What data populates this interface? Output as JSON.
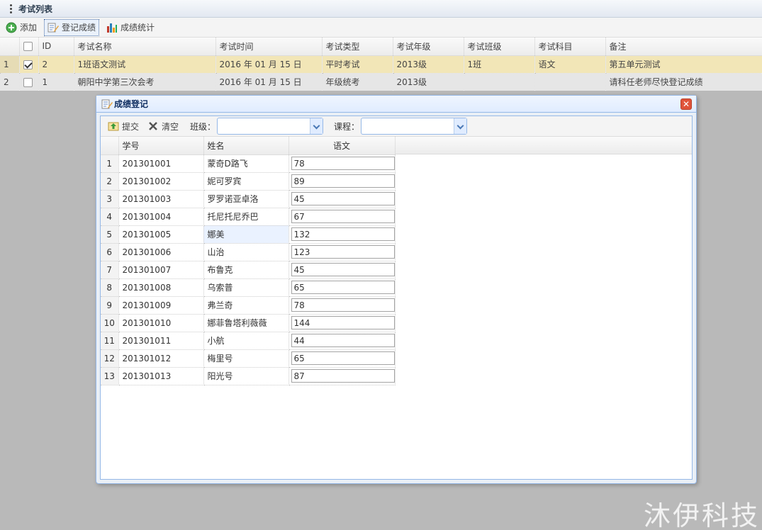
{
  "panel": {
    "title": "考试列表"
  },
  "toolbar": {
    "add_label": "添加",
    "register_label": "登记成绩",
    "stats_label": "成绩统计"
  },
  "grid": {
    "columns": [
      "ID",
      "考试名称",
      "考试时间",
      "考试类型",
      "考试年级",
      "考试班级",
      "考试科目",
      "备注"
    ],
    "rows": [
      {
        "num": "1",
        "checked": true,
        "id": "2",
        "name": "1班语文测试",
        "time": "2016 年 01 月 15 日",
        "type": "平时考试",
        "grade": "2013级",
        "class": "1班",
        "subject": "语文",
        "remark": "第五单元测试"
      },
      {
        "num": "2",
        "checked": false,
        "id": "1",
        "name": "朝阳中学第三次会考",
        "time": "2016 年 01 月 15 日",
        "type": "年级统考",
        "grade": "2013级",
        "class": "",
        "subject": "",
        "remark": "请科任老师尽快登记成绩"
      }
    ]
  },
  "dialog": {
    "title": "成绩登记",
    "submit_label": "提交",
    "clear_label": "清空",
    "class_label": "班级：",
    "course_label": "课程：",
    "class_value": "",
    "course_value": "",
    "columns": [
      "学号",
      "姓名",
      "语文"
    ],
    "students": [
      {
        "num": "1",
        "sid": "201301001",
        "name": "蒙奇D路飞",
        "score": "78"
      },
      {
        "num": "2",
        "sid": "201301002",
        "name": "妮可罗宾",
        "score": "89"
      },
      {
        "num": "3",
        "sid": "201301003",
        "name": "罗罗诺亚卓洛",
        "score": "45"
      },
      {
        "num": "4",
        "sid": "201301004",
        "name": "托尼托尼乔巴",
        "score": "67"
      },
      {
        "num": "5",
        "sid": "201301005",
        "name": "娜美",
        "score": "132"
      },
      {
        "num": "6",
        "sid": "201301006",
        "name": "山治",
        "score": "123"
      },
      {
        "num": "7",
        "sid": "201301007",
        "name": "布鲁克",
        "score": "45"
      },
      {
        "num": "8",
        "sid": "201301008",
        "name": "乌索普",
        "score": "65"
      },
      {
        "num": "9",
        "sid": "201301009",
        "name": "弗兰奇",
        "score": "78"
      },
      {
        "num": "10",
        "sid": "201301010",
        "name": "娜菲鲁塔利薇薇",
        "score": "144"
      },
      {
        "num": "11",
        "sid": "201301011",
        "name": "小航",
        "score": "44"
      },
      {
        "num": "12",
        "sid": "201301012",
        "name": "梅里号",
        "score": "65"
      },
      {
        "num": "13",
        "sid": "201301013",
        "name": "阳光号",
        "score": "87"
      }
    ]
  },
  "watermark": "沐伊科技",
  "colors": {
    "selected_row": "#f2e6b7",
    "dialog_border": "#95b8e7",
    "close_button": "#e0533a"
  }
}
